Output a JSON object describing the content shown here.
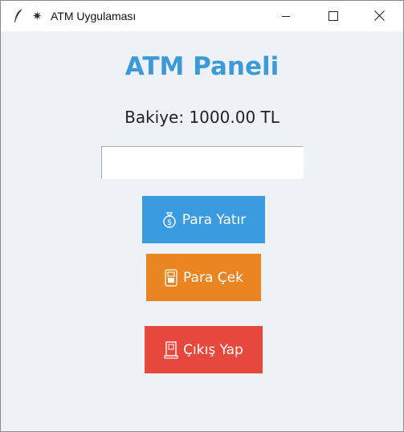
{
  "window": {
    "title": "ATM Uygulaması",
    "app_icon": "feather-icon",
    "title_icon": "sparkle-icon",
    "controls": {
      "minimize": "minimize-icon",
      "maximize": "maximize-icon",
      "close": "close-icon"
    }
  },
  "main": {
    "heading": "ATM Paneli",
    "balance_text": "Bakiye: 1000.00 TL",
    "amount_input": {
      "value": "",
      "placeholder": ""
    },
    "buttons": {
      "deposit": {
        "label": "Para Yatır",
        "icon": "money-bag-icon"
      },
      "withdraw": {
        "label": "Para Çek",
        "icon": "atm-icon"
      },
      "exit": {
        "label": "Çıkış Yap",
        "icon": "exit-door-icon"
      }
    }
  },
  "colors": {
    "heading": "#3d9ad9",
    "background": "#eef1f6",
    "deposit": "#3a9be0",
    "withdraw": "#e98523",
    "exit": "#e7483d"
  }
}
